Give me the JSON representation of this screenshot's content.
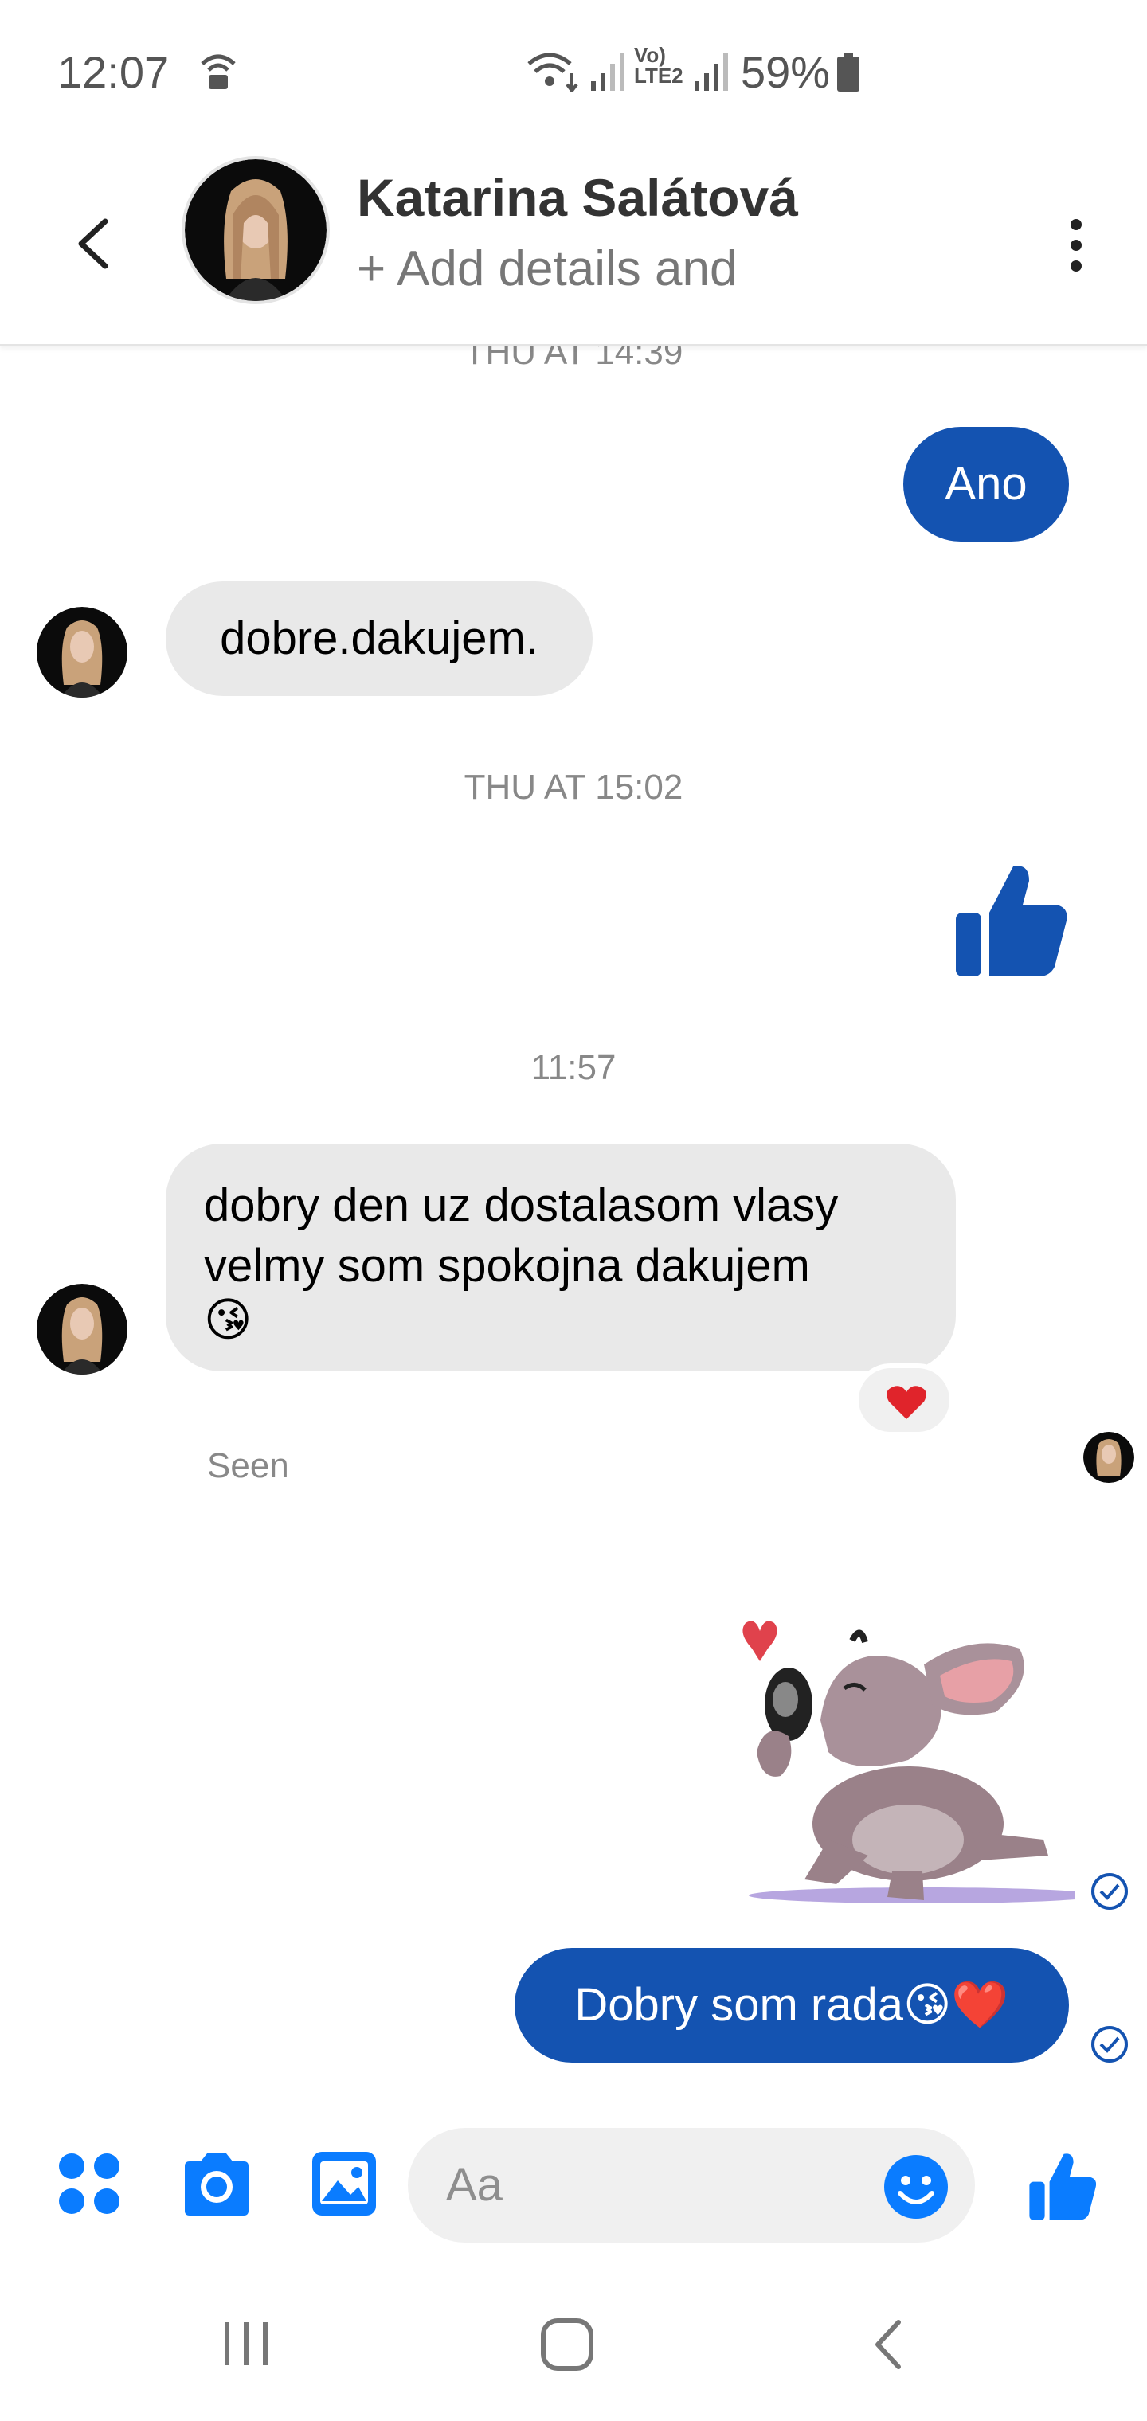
{
  "status_bar": {
    "time": "12:07",
    "battery": "59%",
    "network": "LTE2"
  },
  "header": {
    "name": "Katarina Salátová",
    "subtitle": "+ Add details and"
  },
  "messages": {
    "ts1": "THU AT 14:39",
    "out1": "Ano",
    "in1": "dobre.dakujem.",
    "ts2": "THU AT 15:02",
    "ts3": "11:57",
    "in2_line1": "dobry den uz dostalasom vlasy",
    "in2_line2": "velmy som spokojna dakujem",
    "in2_emoji": "😘",
    "reaction": "❤️",
    "seen": "Seen",
    "out2": "Dobry som rada😘❤️"
  },
  "composer": {
    "placeholder": "Aa"
  },
  "colors": {
    "accent": "#1453b1",
    "icon_blue": "#0a7cff",
    "incoming_bubble": "#e9e9e9"
  },
  "icons": [
    "wifi-lock-icon",
    "wifi-icon",
    "signal-icon",
    "battery-icon",
    "back-icon",
    "more-icon",
    "thumbs-up-icon",
    "heart-icon",
    "check-circle-icon",
    "menu-dots-icon",
    "camera-icon",
    "gallery-icon",
    "emoji-icon",
    "recents-icon",
    "home-icon",
    "nav-back-icon"
  ]
}
